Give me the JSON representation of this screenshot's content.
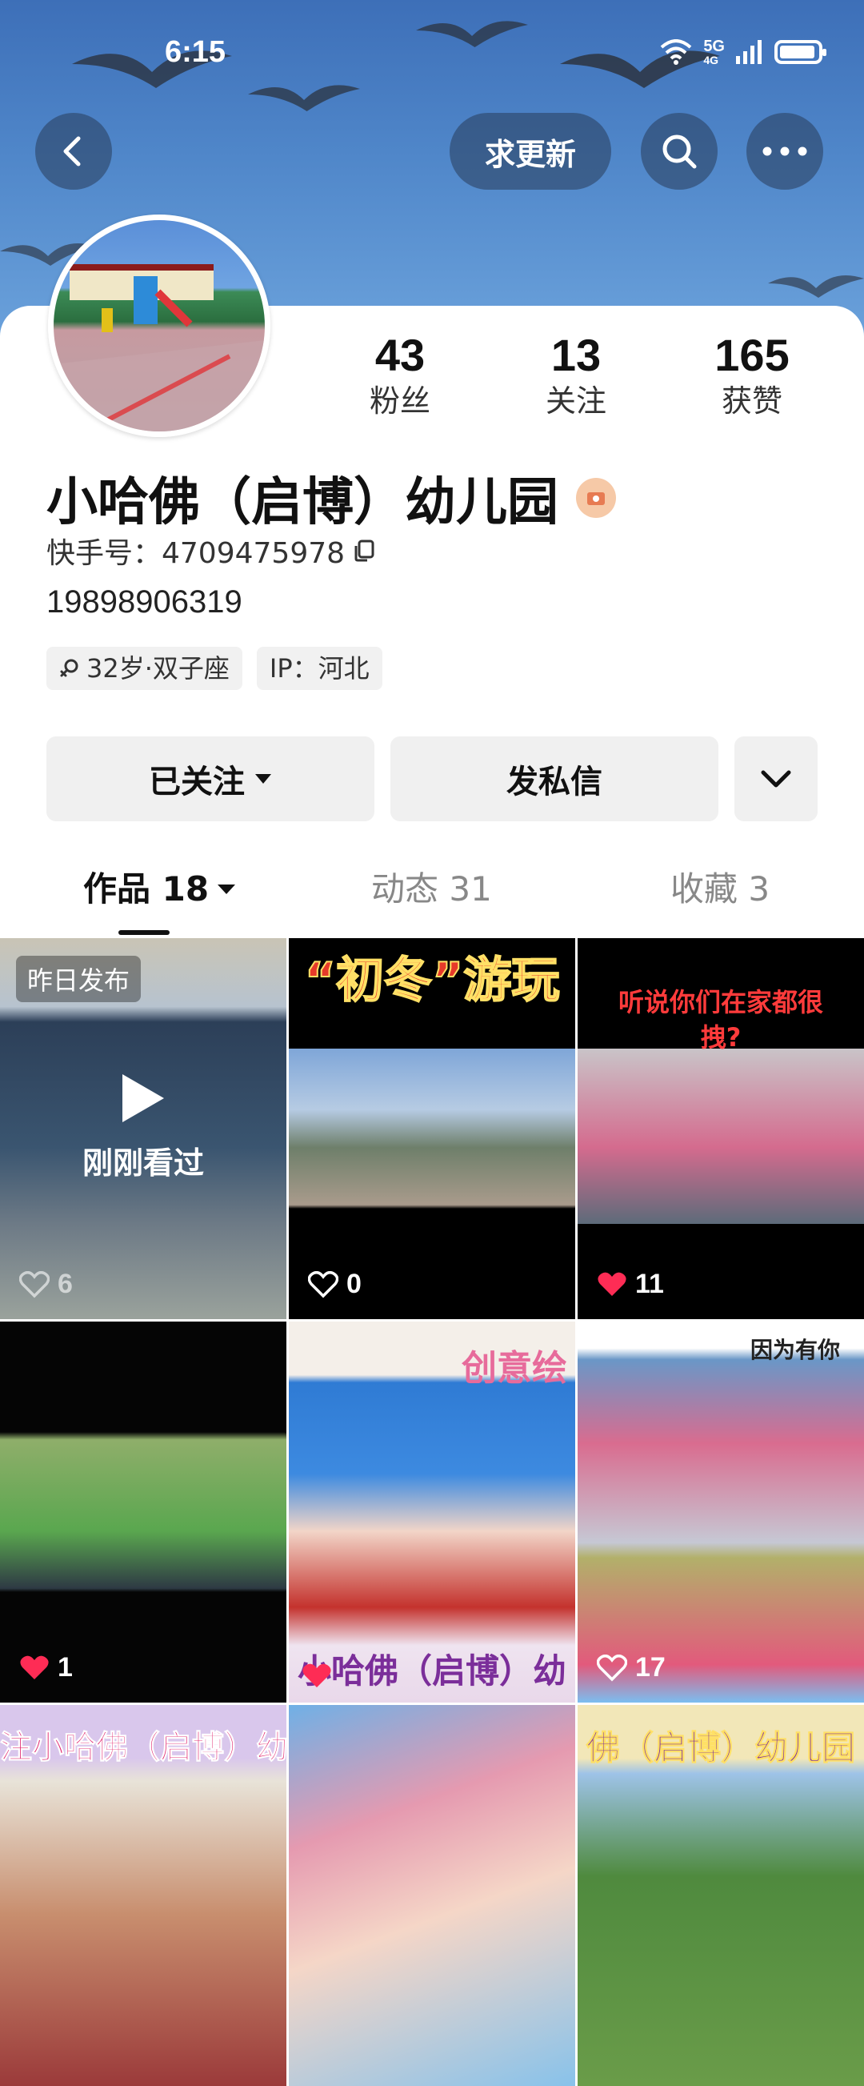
{
  "status_bar": {
    "time": "6:15",
    "network": "5G",
    "network_sub": "4G"
  },
  "header": {
    "request_update_label": "求更新"
  },
  "profile": {
    "stats": [
      {
        "value": "43",
        "label": "粉丝"
      },
      {
        "value": "13",
        "label": "关注"
      },
      {
        "value": "165",
        "label": "获赞"
      }
    ],
    "name": "小哈佛（启博）幼儿园",
    "uid_label": "快手号：4709475978",
    "phone": "19898906319",
    "tags": [
      {
        "label": "32岁·双子座",
        "icon": "female-icon"
      },
      {
        "label": "IP：河北"
      }
    ]
  },
  "actions": {
    "follow_label": "已关注",
    "message_label": "发私信"
  },
  "tabs": [
    {
      "label": "作品 18",
      "active": true
    },
    {
      "label": "动态 31",
      "active": false
    },
    {
      "label": "收藏 3",
      "active": false
    }
  ],
  "videos": [
    {
      "chip": "昨日发布",
      "watched_label": "刚刚看过",
      "likes": "6",
      "liked": false
    },
    {
      "title": "“初冬”游玩",
      "likes": "0",
      "liked": false
    },
    {
      "title": "听说你们在家都很\n拽?",
      "likes": "11",
      "liked": true
    },
    {
      "likes": "1",
      "liked": true
    },
    {
      "title": "创意绘",
      "footer": "小哈佛（启博）幼",
      "likes": "",
      "liked": true
    },
    {
      "title": "因为有你",
      "likes": "17",
      "liked": false
    },
    {
      "title": "注小哈佛（启博）幼儿"
    },
    {
      "title": ""
    },
    {
      "title": "佛（启博）幼儿园"
    }
  ],
  "colors": {
    "accent_red": "#fe2c55",
    "banner": "#4a7fc4"
  }
}
